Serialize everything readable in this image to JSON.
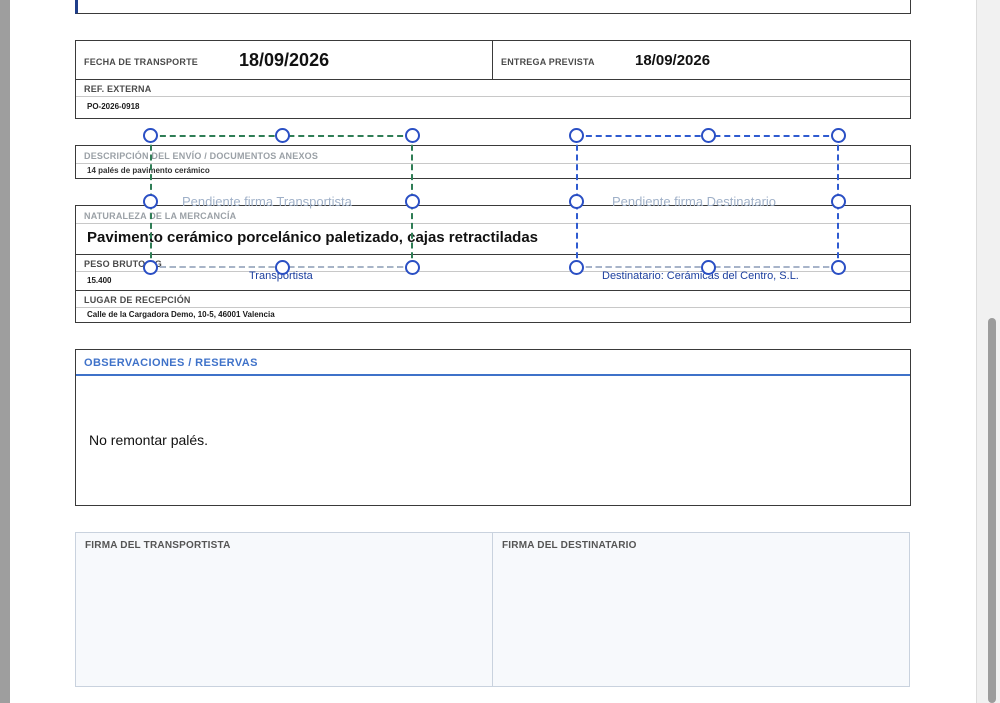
{
  "transport": {
    "fecha_label": "FECHA DE TRANSPORTE",
    "fecha_value": "18/09/2026",
    "entrega_label": "ENTREGA PREVISTA",
    "entrega_value": "18/09/2026"
  },
  "ref": {
    "label": "REF. EXTERNA",
    "value": "PO-2026-0918"
  },
  "descripcion": {
    "label": "DESCRIPCIÓN DEL ENVÍO / DOCUMENTOS ANEXOS",
    "value": "14 palés de pavimento cerámico"
  },
  "naturaleza": {
    "label": "NATURALEZA DE LA MERCANCÍA",
    "value": "Pavimento cerámico porcelánico paletizado, cajas retractiladas"
  },
  "peso": {
    "label": "PESO BRUTO KG",
    "value": "15.400"
  },
  "lugar": {
    "label": "LUGAR DE RECEPCIÓN",
    "value": "Calle de la Cargadora Demo, 10-5, 46001 Valencia"
  },
  "signature_fields": {
    "transportista": {
      "placeholder": "Pendiente firma Transportista",
      "caption": "Transportista",
      "color": "#2f7d55"
    },
    "destinatario": {
      "placeholder": "Pendiente firma Destinatario",
      "caption": "Destinatario: Cerámicas del Centro, S.L.",
      "color": "#2f5bd0"
    }
  },
  "observaciones": {
    "title": "OBSERVACIONES / RESERVAS",
    "text": "No remontar palés."
  },
  "firmas": {
    "transportista_label": "FIRMA DEL TRANSPORTISTA",
    "destinatario_label": "FIRMA DEL DESTINATARIO"
  },
  "colors": {
    "accent": "#3f72c9",
    "handle": "#2a4fc4"
  }
}
